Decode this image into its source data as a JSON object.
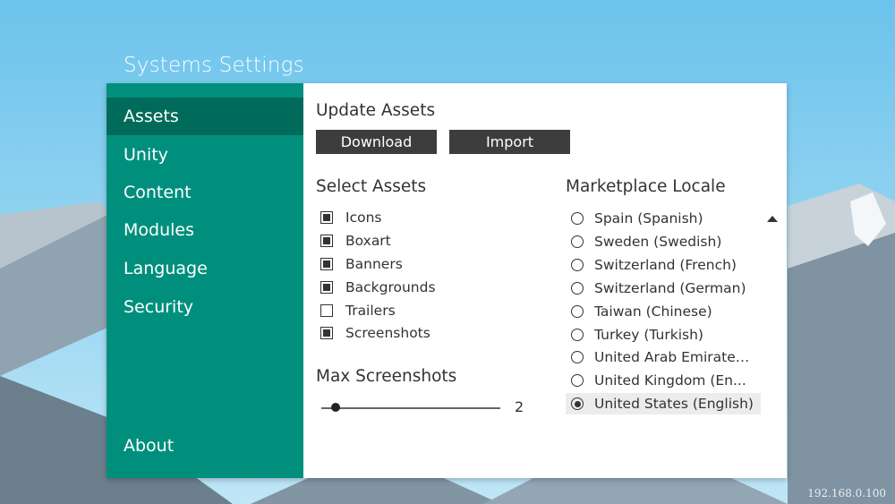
{
  "window": {
    "title": "Systems Settings"
  },
  "sidebar": {
    "items": [
      {
        "label": "Assets",
        "active": true
      },
      {
        "label": "Unity",
        "active": false
      },
      {
        "label": "Content",
        "active": false
      },
      {
        "label": "Modules",
        "active": false
      },
      {
        "label": "Language",
        "active": false
      },
      {
        "label": "Security",
        "active": false
      }
    ],
    "about_label": "About"
  },
  "update_assets": {
    "heading": "Update Assets",
    "download_label": "Download",
    "import_label": "Import"
  },
  "select_assets": {
    "heading": "Select Assets",
    "items": [
      {
        "label": "Icons",
        "checked": true
      },
      {
        "label": "Boxart",
        "checked": true
      },
      {
        "label": "Banners",
        "checked": true
      },
      {
        "label": "Backgrounds",
        "checked": true
      },
      {
        "label": "Trailers",
        "checked": false
      },
      {
        "label": "Screenshots",
        "checked": true
      }
    ]
  },
  "max_screenshots": {
    "heading": "Max Screenshots",
    "value": 2,
    "min": 1,
    "max": 20
  },
  "marketplace_locale": {
    "heading": "Marketplace Locale",
    "options": [
      {
        "label": "Spain (Spanish)",
        "selected": false
      },
      {
        "label": "Sweden (Swedish)",
        "selected": false
      },
      {
        "label": "Switzerland (French)",
        "selected": false
      },
      {
        "label": "Switzerland (German)",
        "selected": false
      },
      {
        "label": "Taiwan (Chinese)",
        "selected": false
      },
      {
        "label": "Turkey (Turkish)",
        "selected": false
      },
      {
        "label": "United Arab Emirates...",
        "selected": false
      },
      {
        "label": "United Kingdom (En...",
        "selected": false
      },
      {
        "label": "United States (English)",
        "selected": true
      }
    ]
  },
  "footer": {
    "ip_address": "192.168.0.100"
  },
  "colors": {
    "accent": "#008f7c",
    "accent_dark": "#006b5a",
    "button": "#3d3d3d",
    "sky": "#8fd0ee"
  }
}
